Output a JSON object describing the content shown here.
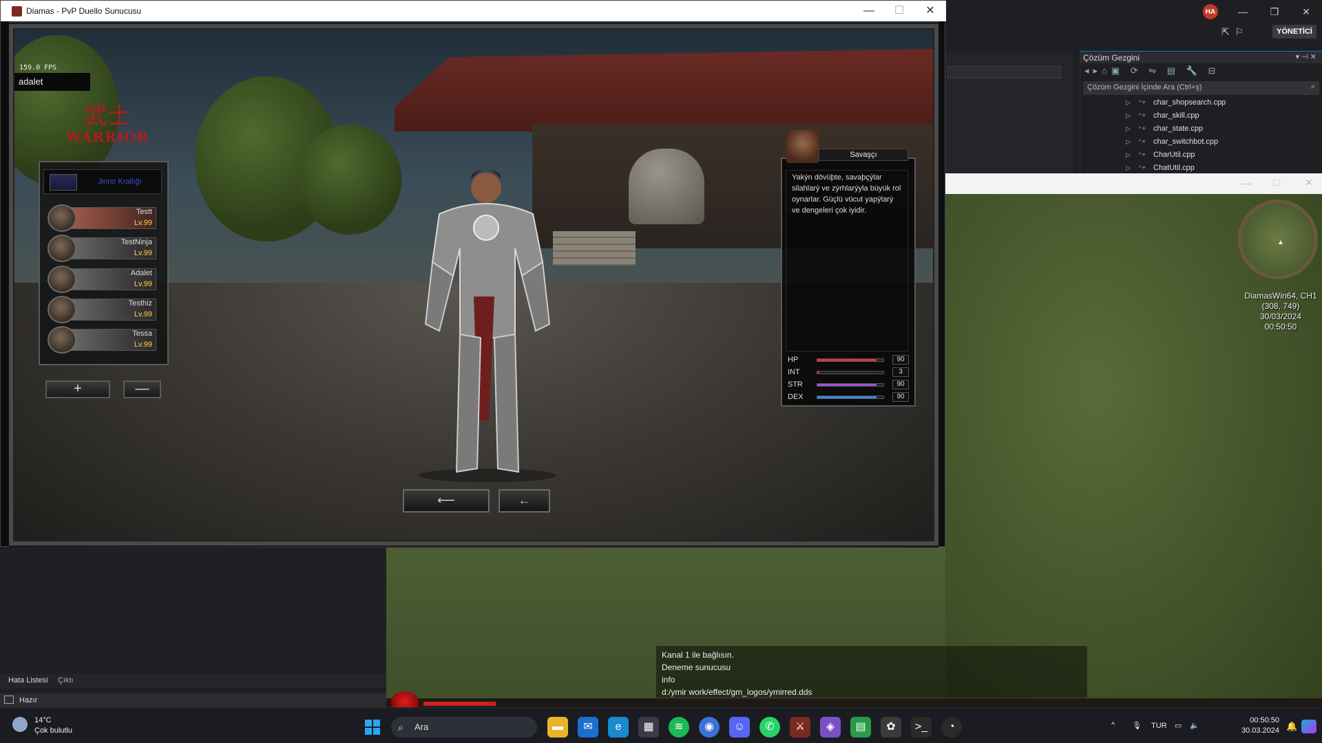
{
  "main_window": {
    "title": "Diamas - PvP Duello Sunucusu"
  },
  "game": {
    "fps": "159.0 FPS",
    "player_name": "adalet",
    "class_kanji": "武士",
    "class_word": "WARRIOR",
    "kingdom": "Jinno Krallığı",
    "characters": [
      {
        "name": "Testt",
        "level": "Lv.99"
      },
      {
        "name": "TestNinja",
        "level": "Lv.99"
      },
      {
        "name": "Adalet",
        "level": "Lv.99"
      },
      {
        "name": "Testhiz",
        "level": "Lv.99"
      },
      {
        "name": "Tessa",
        "level": "Lv.99"
      }
    ],
    "add_button": "+",
    "delete_button": "—",
    "class_info": {
      "class_name": "Savaşçı",
      "description": "Yakýn dövüþte, savaþçýlar silahlarý ve zýrhlarýyla büyük rol oynarlar. Güçlü vücut yapýlarý ve dengeleri çok iyidir."
    },
    "stats": [
      {
        "label": "HP",
        "value": "90",
        "fill": 0.9,
        "color": "#e0304a"
      },
      {
        "label": "INT",
        "value": "3",
        "fill": 0.03,
        "color": "#d02828"
      },
      {
        "label": "STR",
        "value": "90",
        "fill": 0.9,
        "color": "#a050e0"
      },
      {
        "label": "DEX",
        "value": "90",
        "fill": 0.9,
        "color": "#3a8ae0"
      }
    ],
    "nav_left": "⟵",
    "nav_right": "←"
  },
  "game2": {
    "server_line1": "DiamasWin64, CH1",
    "coords": "(308, 749)",
    "date": "30/03/2024",
    "time": "00:50:50"
  },
  "chat": [
    "Kanal 1 ile bağlısın.",
    "Deneme sunucusu",
    "info",
    "d:/ymir work/effect/gm_logos/ymirred.dds"
  ],
  "vs": {
    "avatar": "HA",
    "admin_label": "YÖNETİCİ",
    "solution_explorer_title": "Çözüm Gezgini",
    "solution_search_placeholder": "Çözüm Gezgini İçinde Ara (Ctrl+ş)",
    "files": [
      "char_shopsearch.cpp",
      "char_skill.cpp",
      "char_state.cpp",
      "char_switchbot.cpp",
      "CharUtil.cpp",
      "ChatUtil.cpp"
    ],
    "bottom_tabs": [
      "Hata Listesi",
      "Çıktı"
    ],
    "status": "Hazır"
  },
  "taskbar": {
    "weather_temp": "14°C",
    "weather_desc": "Çok bulutlu",
    "search_label": "Ara",
    "language": "TUR",
    "clock_time": "00:50:50",
    "clock_date": "30.03.2024"
  }
}
